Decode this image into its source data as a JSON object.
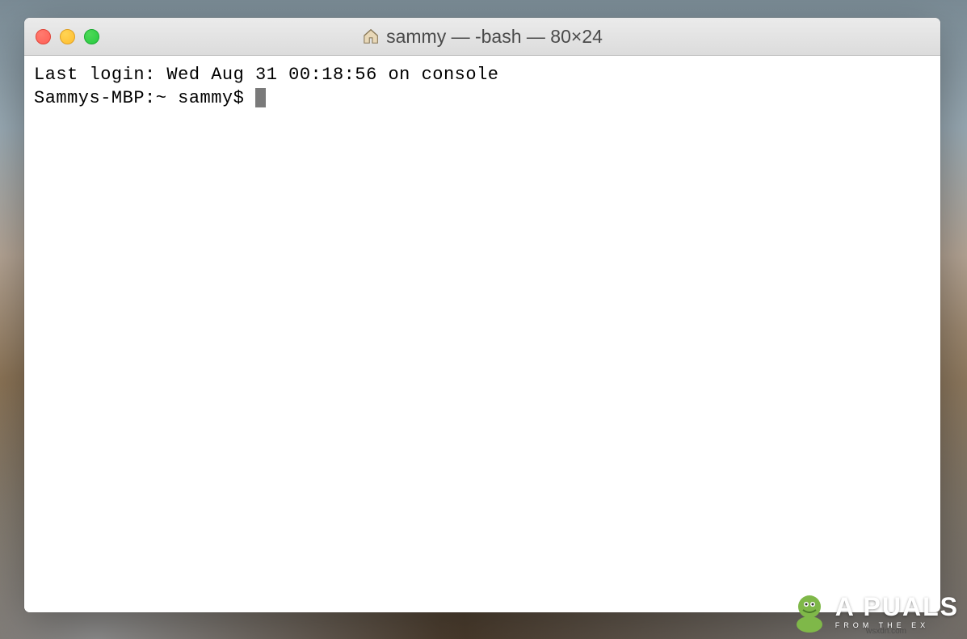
{
  "window": {
    "title": "sammy — -bash — 80×24",
    "traffic_lights": {
      "close": "close",
      "minimize": "minimize",
      "maximize": "maximize"
    }
  },
  "terminal": {
    "lines": [
      "Last login: Wed Aug 31 00:18:56 on console",
      "Sammys-MBP:~ sammy$ "
    ]
  },
  "watermark": {
    "brand": "A PUALS",
    "tagline": "FROM THE EX",
    "url": "wsxdn.com"
  }
}
